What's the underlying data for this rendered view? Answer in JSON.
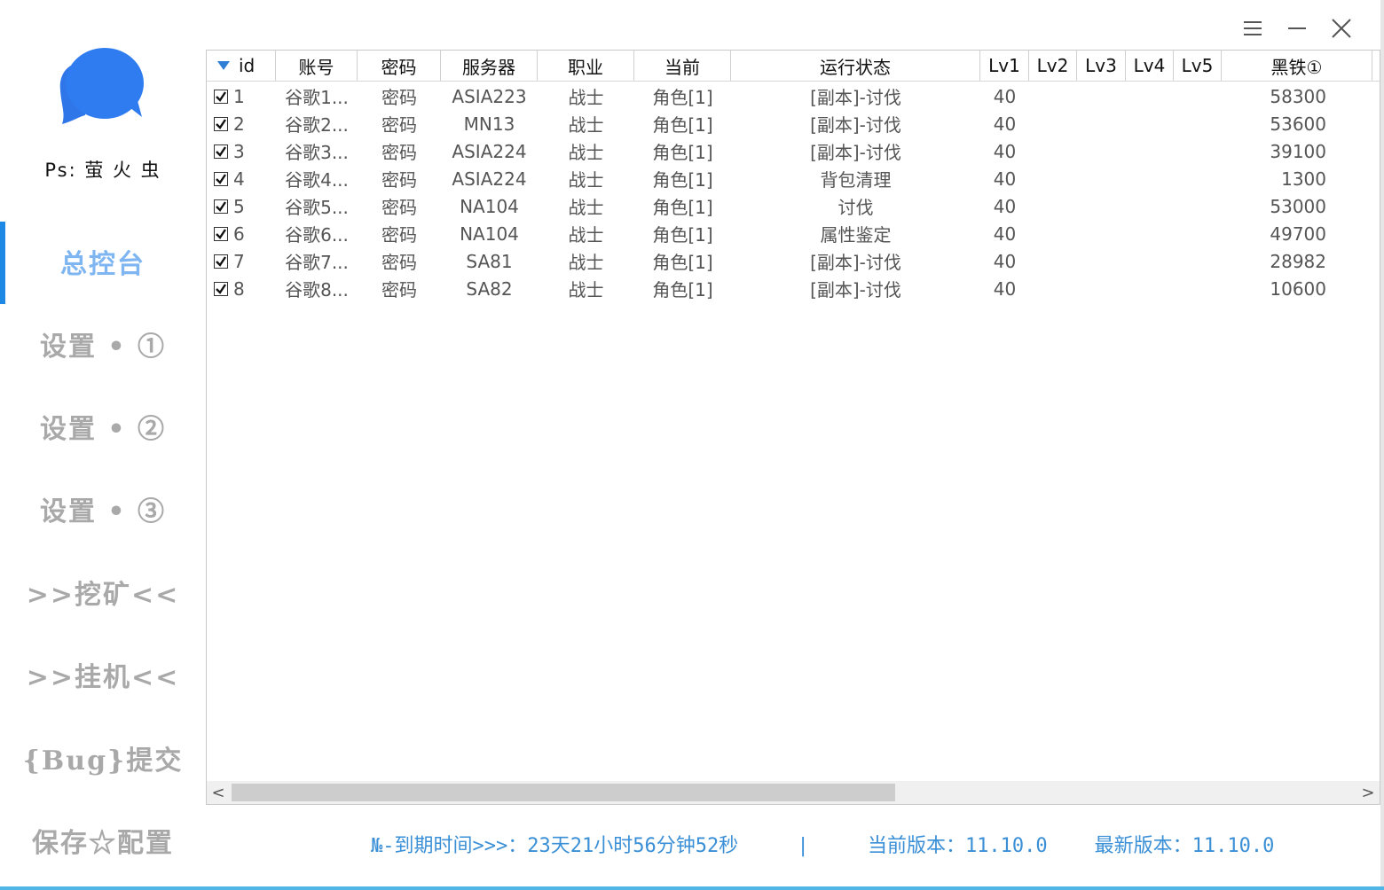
{
  "window": {
    "menu_icon": "menu-icon",
    "minimize_icon": "minimize-icon",
    "close_icon": "close-icon"
  },
  "sidebar": {
    "logo_icon": "chat-bubbles-icon",
    "ps_label": "Ps: 萤 火 虫",
    "items": [
      {
        "label": "总控台",
        "active": true
      },
      {
        "label": "设置 • ①"
      },
      {
        "label": "设置 • ②"
      },
      {
        "label": "设置 • ③"
      },
      {
        "label": ">>挖矿<<"
      },
      {
        "label": ">>挂机<<"
      },
      {
        "label": "{Bug}提交"
      },
      {
        "label": "保存☆配置"
      }
    ]
  },
  "table": {
    "columns": [
      "id",
      "账号",
      "密码",
      "服务器",
      "职业",
      "当前",
      "运行状态",
      "Lv1",
      "Lv2",
      "Lv3",
      "Lv4",
      "Lv5",
      "黑铁①"
    ],
    "rows": [
      {
        "id": "1",
        "account": "谷歌1...",
        "password": "密码",
        "server": "ASIA223",
        "job": "战士",
        "current": "角色[1]",
        "status": "[副本]-讨伐",
        "lv1": "40",
        "lv2": "",
        "lv3": "",
        "lv4": "",
        "lv5": "",
        "iron": "58300"
      },
      {
        "id": "2",
        "account": "谷歌2...",
        "password": "密码",
        "server": "MN13",
        "job": "战士",
        "current": "角色[1]",
        "status": "[副本]-讨伐",
        "lv1": "40",
        "lv2": "",
        "lv3": "",
        "lv4": "",
        "lv5": "",
        "iron": "53600"
      },
      {
        "id": "3",
        "account": "谷歌3...",
        "password": "密码",
        "server": "ASIA224",
        "job": "战士",
        "current": "角色[1]",
        "status": "[副本]-讨伐",
        "lv1": "40",
        "lv2": "",
        "lv3": "",
        "lv4": "",
        "lv5": "",
        "iron": "39100"
      },
      {
        "id": "4",
        "account": "谷歌4...",
        "password": "密码",
        "server": "ASIA224",
        "job": "战士",
        "current": "角色[1]",
        "status": "背包清理",
        "lv1": "40",
        "lv2": "",
        "lv3": "",
        "lv4": "",
        "lv5": "",
        "iron": "1300"
      },
      {
        "id": "5",
        "account": "谷歌5...",
        "password": "密码",
        "server": "NA104",
        "job": "战士",
        "current": "角色[1]",
        "status": "讨伐",
        "lv1": "40",
        "lv2": "",
        "lv3": "",
        "lv4": "",
        "lv5": "",
        "iron": "53000"
      },
      {
        "id": "6",
        "account": "谷歌6...",
        "password": "密码",
        "server": "NA104",
        "job": "战士",
        "current": "角色[1]",
        "status": "属性鉴定",
        "lv1": "40",
        "lv2": "",
        "lv3": "",
        "lv4": "",
        "lv5": "",
        "iron": "49700"
      },
      {
        "id": "7",
        "account": "谷歌7...",
        "password": "密码",
        "server": "SA81",
        "job": "战士",
        "current": "角色[1]",
        "status": "[副本]-讨伐",
        "lv1": "40",
        "lv2": "",
        "lv3": "",
        "lv4": "",
        "lv5": "",
        "iron": "28982"
      },
      {
        "id": "8",
        "account": "谷歌8...",
        "password": "密码",
        "server": "SA82",
        "job": "战士",
        "current": "角色[1]",
        "status": "[副本]-讨伐",
        "lv1": "40",
        "lv2": "",
        "lv3": "",
        "lv4": "",
        "lv5": "",
        "iron": "10600"
      }
    ]
  },
  "scrollbar": {
    "left_arrow": "<",
    "right_arrow": ">"
  },
  "statusbar": {
    "expiry": "№-到期时间>>>：23天21小时56分钟52秒",
    "separator": "|",
    "current_version": "当前版本：11.10.0",
    "latest_version": "最新版本：11.10.0"
  },
  "colors": {
    "accent": "#1e88e5",
    "active_nav": "#7fb6f2",
    "inactive_nav": "#a9a9a9",
    "status_text": "#3a8fd6"
  }
}
